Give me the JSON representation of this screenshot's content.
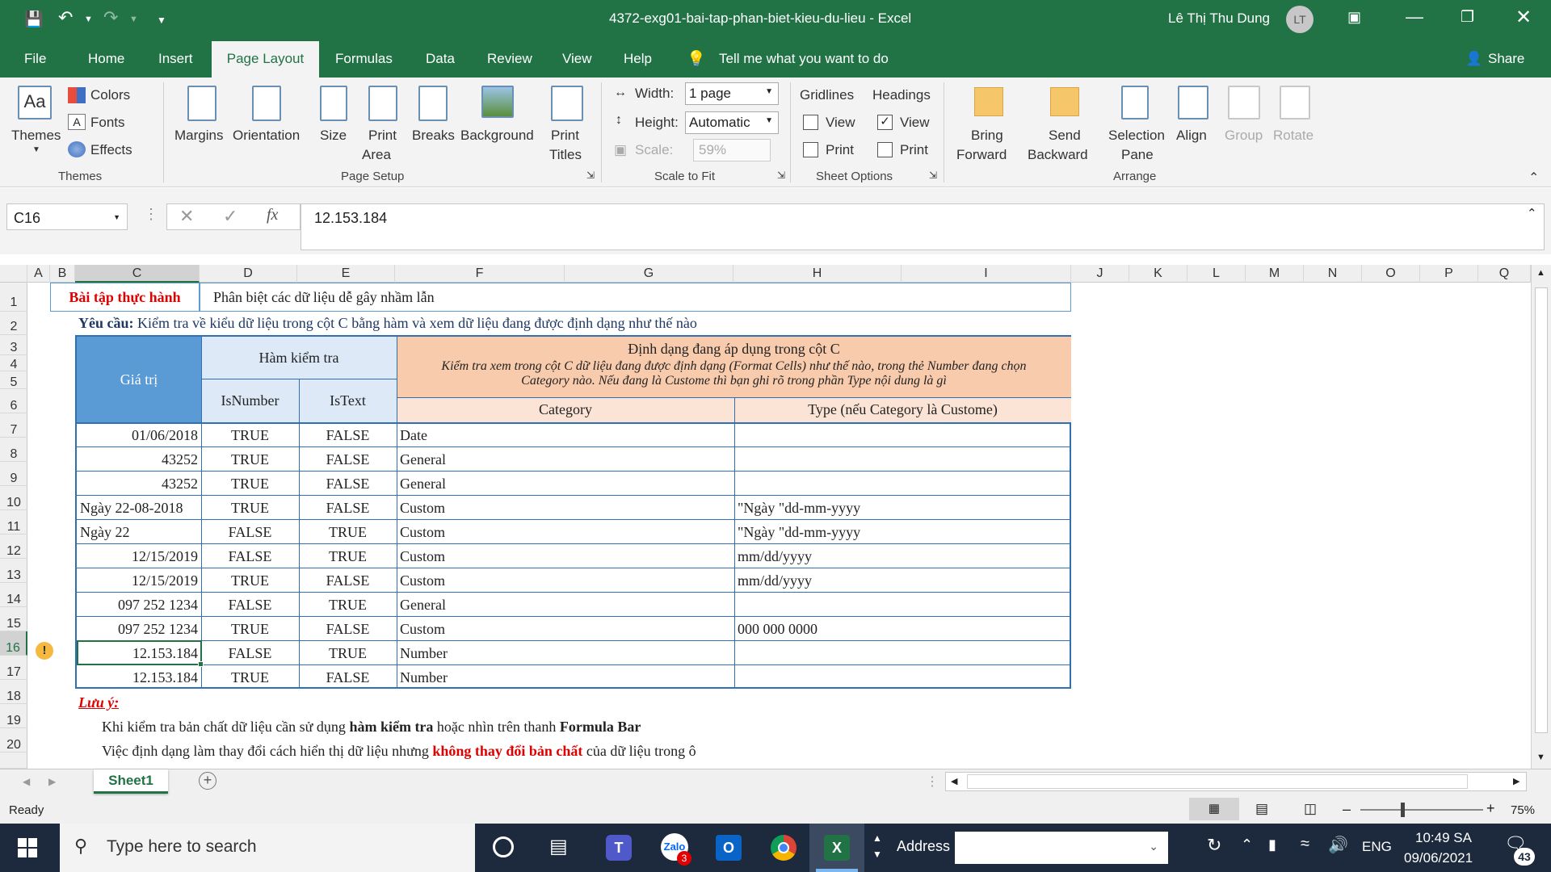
{
  "window": {
    "title": "4372-exg01-bai-tap-phan-biet-kieu-du-lieu  -  Excel",
    "user": "Lê Thị Thu Dung",
    "user_initials": "LT"
  },
  "tabs": [
    "File",
    "Home",
    "Insert",
    "Page Layout",
    "Formulas",
    "Data",
    "Review",
    "View",
    "Help"
  ],
  "tell_me": "Tell me what you want to do",
  "share": "Share",
  "ribbon": {
    "themes": {
      "themes_label": "Themes",
      "colors": "Colors",
      "fonts": "Fonts",
      "effects": "Effects",
      "group": "Themes"
    },
    "page_setup": {
      "margins": "Margins",
      "orientation": "Orientation",
      "size": "Size",
      "print_area_1": "Print",
      "print_area_2": "Area",
      "breaks": "Breaks",
      "background": "Background",
      "print_titles_1": "Print",
      "print_titles_2": "Titles",
      "group": "Page Setup"
    },
    "scale": {
      "width_label": "Width:",
      "width_value": "1 page",
      "height_label": "Height:",
      "height_value": "Automatic",
      "scale_label": "Scale:",
      "scale_value": "59%",
      "group": "Scale to Fit"
    },
    "sheet_options": {
      "gridlines": "Gridlines",
      "headings": "Headings",
      "view": "View",
      "print": "Print",
      "group": "Sheet Options"
    },
    "arrange": {
      "bring_1": "Bring",
      "bring_2": "Forward",
      "send_1": "Send",
      "send_2": "Backward",
      "sel_1": "Selection",
      "sel_2": "Pane",
      "align": "Align",
      "group_btn": "Group",
      "rotate": "Rotate",
      "group": "Arrange"
    }
  },
  "formula_bar": {
    "cell_ref": "C16",
    "value": "12.153.184",
    "fx": "fx"
  },
  "columns": [
    "A",
    "B",
    "C",
    "D",
    "E",
    "F",
    "G",
    "H",
    "I",
    "J",
    "K",
    "L",
    "M",
    "N",
    "O",
    "P",
    "Q"
  ],
  "rows": [
    "1",
    "2",
    "3",
    "4",
    "5",
    "6",
    "7",
    "8",
    "9",
    "10",
    "11",
    "12",
    "13",
    "14",
    "15",
    "16",
    "17",
    "18",
    "19",
    "20"
  ],
  "sheet": {
    "r1_title": "Bài tập thực hành",
    "r1_desc": "Phân biệt các dữ liệu dễ gây nhầm lẫn",
    "r2_label": "Yêu cầu:",
    "r2_text": " Kiểm tra về kiểu dữ liệu trong cột C bằng hàm và xem dữ liệu đang được định dạng như thế nào",
    "h_value": "Giá trị",
    "h_func": "Hàm kiểm tra",
    "h_isnumber": "IsNumber",
    "h_istext": "IsText",
    "h_format": "Định dạng đang áp dụng trong cột C",
    "h_format_note_1": "Kiểm tra xem trong cột C dữ liệu đang được định dạng (Format Cells) như thế nào, trong thẻ Number đang chọn",
    "h_format_note_2": "Category nào. Nếu đang là Custome thì bạn ghi rõ trong phần Type nội dung là gì",
    "h_category": "Category",
    "h_type": "Type (nếu Category là Custome)",
    "data": [
      {
        "value": "01/06/2018",
        "align": "right",
        "isnumber": "TRUE",
        "istext": "FALSE",
        "category": "Date",
        "type": ""
      },
      {
        "value": "43252",
        "align": "right",
        "isnumber": "TRUE",
        "istext": "FALSE",
        "category": "General",
        "type": ""
      },
      {
        "value": "43252",
        "align": "right",
        "isnumber": "TRUE",
        "istext": "FALSE",
        "category": "General",
        "type": ""
      },
      {
        "value": "Ngày 22-08-2018",
        "align": "left",
        "isnumber": "TRUE",
        "istext": "FALSE",
        "category": "Custom",
        "type": "\"Ngày \"dd-mm-yyyy"
      },
      {
        "value": "Ngày 22",
        "align": "left",
        "isnumber": "FALSE",
        "istext": "TRUE",
        "category": "Custom",
        "type": "\"Ngày \"dd-mm-yyyy"
      },
      {
        "value": "12/15/2019",
        "align": "right",
        "isnumber": "FALSE",
        "istext": "TRUE",
        "category": "Custom",
        "type": "mm/dd/yyyy"
      },
      {
        "value": "12/15/2019",
        "align": "right",
        "isnumber": "TRUE",
        "istext": "FALSE",
        "category": "Custom",
        "type": "mm/dd/yyyy"
      },
      {
        "value": "097 252 1234",
        "align": "right",
        "isnumber": "FALSE",
        "istext": "TRUE",
        "category": "General",
        "type": ""
      },
      {
        "value": "097 252 1234",
        "align": "right",
        "isnumber": "TRUE",
        "istext": "FALSE",
        "category": "Custom",
        "type": "000 000 0000"
      },
      {
        "value": "12.153.184",
        "align": "right",
        "isnumber": "FALSE",
        "istext": "TRUE",
        "category": "Number",
        "type": ""
      },
      {
        "value": "12.153.184",
        "align": "right",
        "isnumber": "TRUE",
        "istext": "FALSE",
        "category": "Number",
        "type": ""
      }
    ],
    "note_title": "Lưu ý:",
    "note1_a": "Khi kiểm tra bản chất dữ liệu cần sử dụng ",
    "note1_b": "hàm kiểm tra",
    "note1_c": " hoặc nhìn trên thanh ",
    "note1_d": "Formula Bar",
    "note2_a": "Việc định dạng làm thay đổi cách hiển thị dữ liệu nhưng ",
    "note2_b": "không thay đổi bản chất",
    "note2_c": " của dữ liệu trong ô"
  },
  "sheet_tab": "Sheet1",
  "status": {
    "ready": "Ready",
    "zoom": "75%"
  },
  "taskbar": {
    "search": "Type here to search",
    "address": "Address",
    "lang": "ENG",
    "time": "10:49 SA",
    "date": "09/06/2021",
    "notif": "43",
    "zoom_badge": "3"
  },
  "colors": {
    "excel_green": "#217346",
    "header_blue": "#5b9bd5",
    "header_light_blue": "#dde9f7",
    "header_orange": "#f8cbad",
    "header_light_orange": "#fbe4d5",
    "red_text": "#e00000"
  }
}
